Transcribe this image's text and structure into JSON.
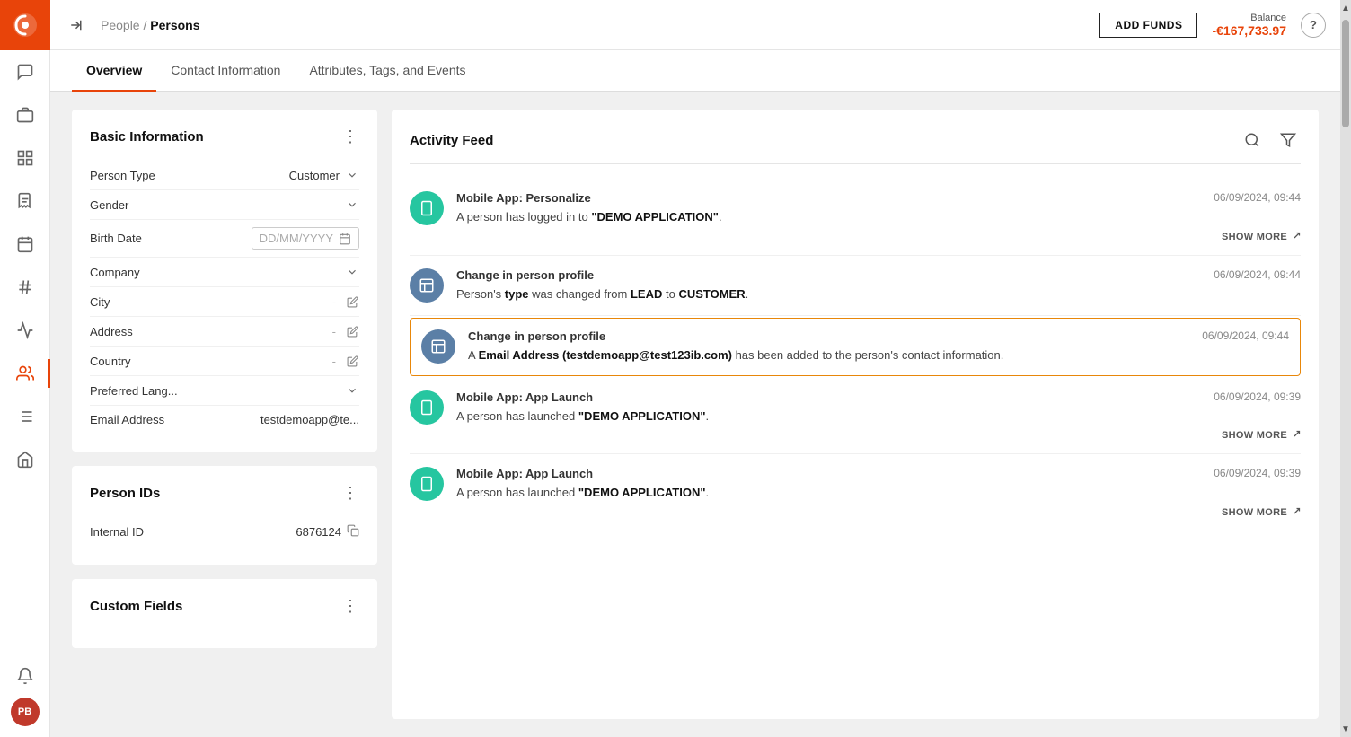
{
  "app": {
    "logo_alt": "App Logo"
  },
  "header": {
    "breadcrumb_prefix": "People / ",
    "breadcrumb_current": "Persons",
    "add_funds_label": "ADD FUNDS",
    "balance_label": "Balance",
    "balance_value": "-€167,733.97",
    "help_label": "?"
  },
  "tabs": [
    {
      "id": "overview",
      "label": "Overview",
      "active": true
    },
    {
      "id": "contact",
      "label": "Contact Information",
      "active": false
    },
    {
      "id": "attributes",
      "label": "Attributes, Tags, and Events",
      "active": false
    }
  ],
  "basic_info": {
    "title": "Basic Information",
    "fields": [
      {
        "label": "Person Type",
        "value": "Customer",
        "type": "dropdown"
      },
      {
        "label": "Gender",
        "value": "",
        "type": "dropdown"
      },
      {
        "label": "Birth Date",
        "value": "DD/MM/YYYY",
        "type": "date"
      },
      {
        "label": "Company",
        "value": "",
        "type": "dropdown"
      },
      {
        "label": "City",
        "value": "-",
        "type": "edit"
      },
      {
        "label": "Address",
        "value": "-",
        "type": "edit"
      },
      {
        "label": "Country",
        "value": "-",
        "type": "edit"
      },
      {
        "label": "Preferred Lang...",
        "value": "",
        "type": "dropdown"
      },
      {
        "label": "Email Address",
        "value": "testdemoapp@te...",
        "type": "text"
      }
    ]
  },
  "person_ids": {
    "title": "Person IDs",
    "ids": [
      {
        "label": "Internal ID",
        "value": "6876124"
      }
    ]
  },
  "activity_feed": {
    "title": "Activity Feed",
    "items": [
      {
        "id": "af1",
        "icon": "mobile",
        "icon_class": "dot-teal",
        "title": "Mobile App: Personalize",
        "time": "06/09/2024, 09:44",
        "body_prefix": "A person has logged in to ",
        "body_bold": "\"DEMO APPLICATION\"",
        "body_suffix": ".",
        "show_more": true,
        "highlighted": false
      },
      {
        "id": "af2",
        "icon": "person",
        "icon_class": "dot-slate",
        "title": "Change in person profile",
        "time": "06/09/2024, 09:44",
        "body_prefix": "Person's ",
        "body_bold_1": "type",
        "body_mid": " was changed from ",
        "body_bold_2": "LEAD",
        "body_mid2": " to ",
        "body_bold_3": "CUSTOMER",
        "body_suffix": ".",
        "show_more": false,
        "highlighted": false,
        "type": "type_change"
      },
      {
        "id": "af3",
        "icon": "person",
        "icon_class": "dot-slate",
        "title": "Change in person profile",
        "time": "06/09/2024, 09:44",
        "body_prefix": "A ",
        "body_bold_1": "Email Address (testdemoapp@test123ib.com)",
        "body_mid": " has been added to the person's contact information.",
        "show_more": false,
        "highlighted": true,
        "type": "email_add"
      },
      {
        "id": "af4",
        "icon": "mobile",
        "icon_class": "dot-teal",
        "title": "Mobile App: App Launch",
        "time": "06/09/2024, 09:39",
        "body_prefix": "A person has launched ",
        "body_bold": "\"DEMO APPLICATION\"",
        "body_suffix": ".",
        "show_more": true,
        "highlighted": false
      },
      {
        "id": "af5",
        "icon": "mobile",
        "icon_class": "dot-teal",
        "title": "Mobile App: App Launch",
        "time": "06/09/2024, 09:39",
        "body_prefix": "A person has launched ",
        "body_bold": "\"DEMO APPLICATION\"",
        "body_suffix": ".",
        "show_more": true,
        "highlighted": false
      }
    ]
  },
  "sidebar": {
    "icons": [
      {
        "id": "chat",
        "label": "chat-icon"
      },
      {
        "id": "briefcase",
        "label": "briefcase-icon"
      },
      {
        "id": "chart",
        "label": "chart-icon"
      },
      {
        "id": "receipt",
        "label": "receipt-icon"
      },
      {
        "id": "calendar",
        "label": "calendar-icon"
      },
      {
        "id": "hashtag",
        "label": "hashtag-icon"
      },
      {
        "id": "analytics",
        "label": "analytics-icon"
      },
      {
        "id": "people",
        "label": "people-icon",
        "active": true
      },
      {
        "id": "list",
        "label": "list-icon"
      },
      {
        "id": "store",
        "label": "store-icon"
      }
    ],
    "user_initials": "PB"
  }
}
